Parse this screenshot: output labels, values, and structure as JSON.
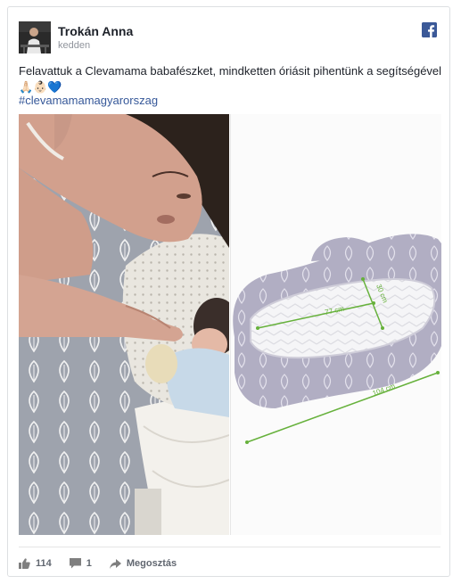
{
  "post": {
    "author": "Trokán Anna",
    "time": "kedden",
    "text": "Felavattuk a Clevamama babafészket, mindketten óriásit pihentünk a segítségével",
    "emojis": "🙏🏻👶🏻💙",
    "hashtag": "#clevamamamagyarorszag"
  },
  "product_dims": {
    "length": "77 cm",
    "width": "30 cm",
    "total": "104 cm"
  },
  "footer": {
    "likes": "114",
    "comments": "1",
    "share_label": "Megosztás"
  },
  "colors": {
    "facebook_blue": "#3b5998",
    "hashtag": "#365899",
    "nest_gray": "#a9a7bd",
    "measure_green": "#66b13b"
  },
  "icons": [
    "facebook-icon",
    "like-icon",
    "comment-icon",
    "share-icon"
  ]
}
